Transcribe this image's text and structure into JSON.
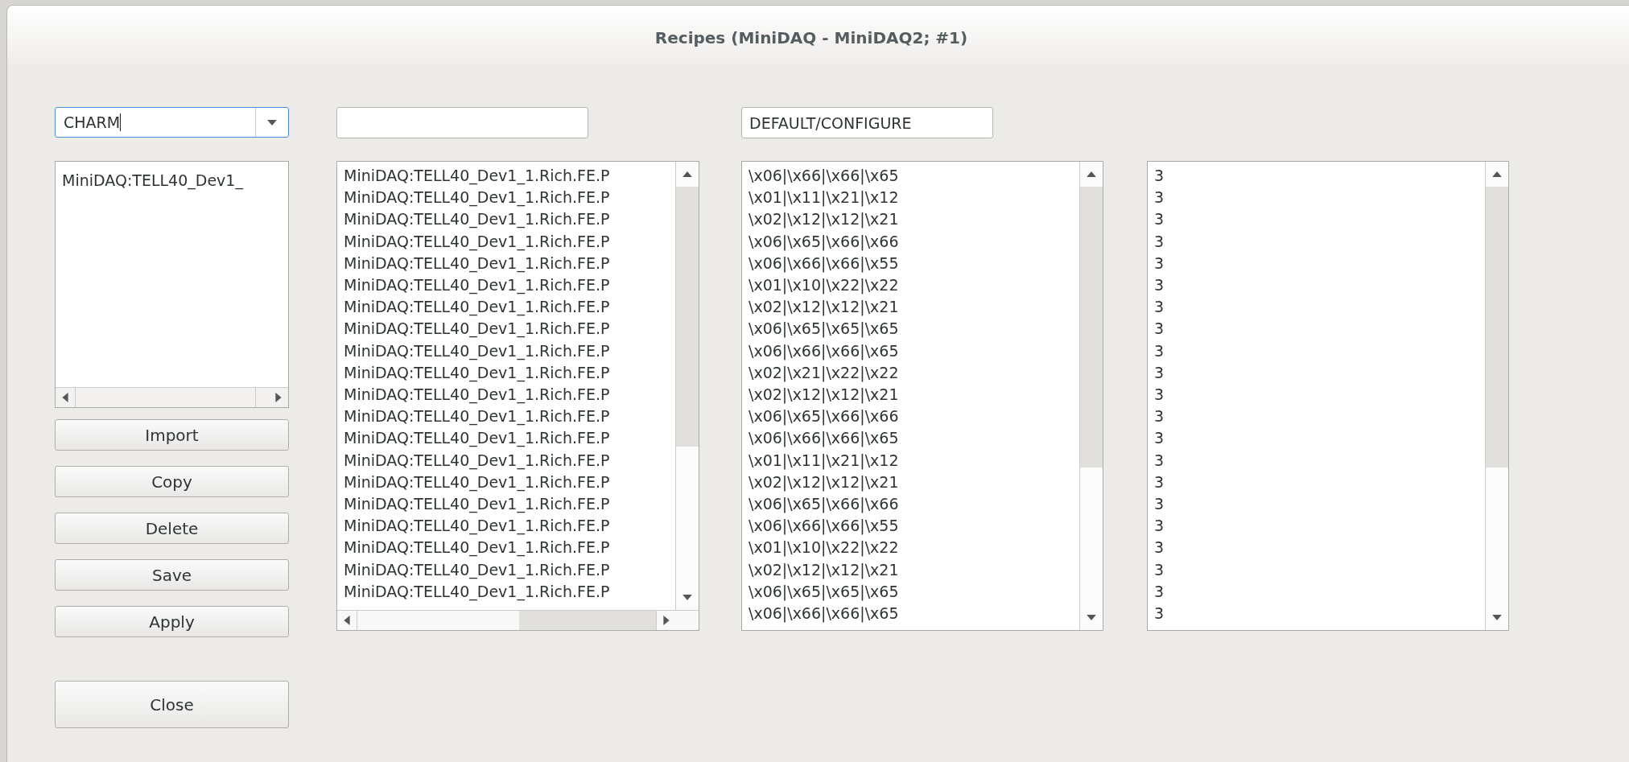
{
  "window": {
    "title": "Recipes (MiniDAQ - MiniDAQ2; #1)"
  },
  "recipe_combo": {
    "value": "CHARM"
  },
  "recipe_list": {
    "items": [
      "MiniDAQ:TELL40_Dev1_"
    ]
  },
  "buttons": [
    "Import",
    "Copy",
    "Delete",
    "Save",
    "Apply"
  ],
  "close_button": "Close",
  "mode_field": {
    "value": "DEFAULT/CONFIGURE"
  },
  "datapoint_list": {
    "items": [
      "MiniDAQ:TELL40_Dev1_1.Rich.FE.P",
      "MiniDAQ:TELL40_Dev1_1.Rich.FE.P",
      "MiniDAQ:TELL40_Dev1_1.Rich.FE.P",
      "MiniDAQ:TELL40_Dev1_1.Rich.FE.P",
      "MiniDAQ:TELL40_Dev1_1.Rich.FE.P",
      "MiniDAQ:TELL40_Dev1_1.Rich.FE.P",
      "MiniDAQ:TELL40_Dev1_1.Rich.FE.P",
      "MiniDAQ:TELL40_Dev1_1.Rich.FE.P",
      "MiniDAQ:TELL40_Dev1_1.Rich.FE.P",
      "MiniDAQ:TELL40_Dev1_1.Rich.FE.P",
      "MiniDAQ:TELL40_Dev1_1.Rich.FE.P",
      "MiniDAQ:TELL40_Dev1_1.Rich.FE.P",
      "MiniDAQ:TELL40_Dev1_1.Rich.FE.P",
      "MiniDAQ:TELL40_Dev1_1.Rich.FE.P",
      "MiniDAQ:TELL40_Dev1_1.Rich.FE.P",
      "MiniDAQ:TELL40_Dev1_1.Rich.FE.P",
      "MiniDAQ:TELL40_Dev1_1.Rich.FE.P",
      "MiniDAQ:TELL40_Dev1_1.Rich.FE.P",
      "MiniDAQ:TELL40_Dev1_1.Rich.FE.P",
      "MiniDAQ:TELL40_Dev1_1.Rich.FE.P"
    ]
  },
  "value_list": {
    "items": [
      "\\x06|\\x66|\\x66|\\x65",
      "\\x01|\\x11|\\x21|\\x12",
      "\\x02|\\x12|\\x12|\\x21",
      "\\x06|\\x65|\\x66|\\x66",
      "\\x06|\\x66|\\x66|\\x55",
      "\\x01|\\x10|\\x22|\\x22",
      "\\x02|\\x12|\\x12|\\x21",
      "\\x06|\\x65|\\x65|\\x65",
      "\\x06|\\x66|\\x66|\\x65",
      "\\x02|\\x21|\\x22|\\x22",
      "\\x02|\\x12|\\x12|\\x21",
      "\\x06|\\x65|\\x66|\\x66",
      "\\x06|\\x66|\\x66|\\x65",
      "\\x01|\\x11|\\x21|\\x12",
      "\\x02|\\x12|\\x12|\\x21",
      "\\x06|\\x65|\\x66|\\x66",
      "\\x06|\\x66|\\x66|\\x55",
      "\\x01|\\x10|\\x22|\\x22",
      "\\x02|\\x12|\\x12|\\x21",
      "\\x06|\\x65|\\x65|\\x65",
      "\\x06|\\x66|\\x66|\\x65"
    ]
  },
  "type_list": {
    "items": [
      "3",
      "3",
      "3",
      "3",
      "3",
      "3",
      "3",
      "3",
      "3",
      "3",
      "3",
      "3",
      "3",
      "3",
      "3",
      "3",
      "3",
      "3",
      "3",
      "3",
      "3"
    ]
  }
}
